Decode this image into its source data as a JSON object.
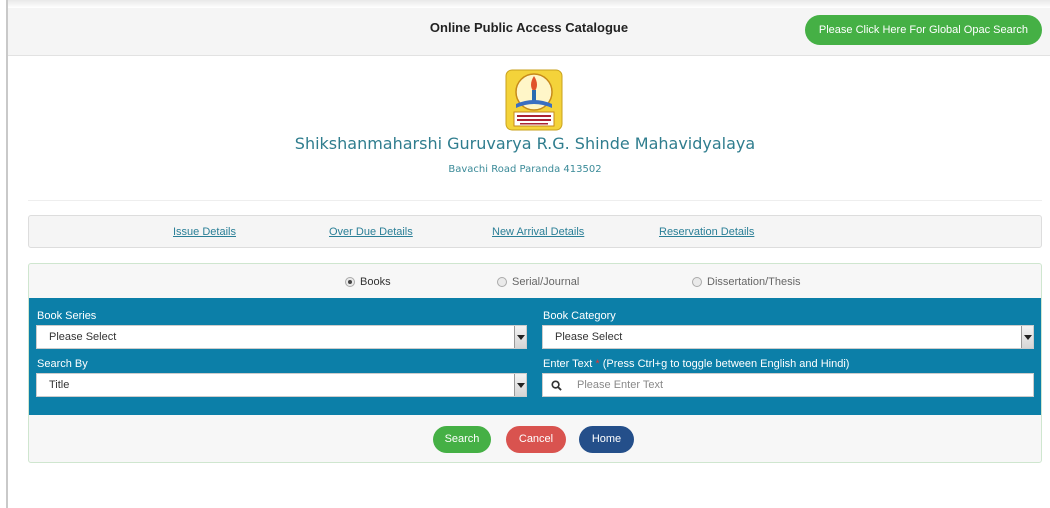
{
  "header": {
    "title": "Online Public Access Catalogue",
    "global_search_label": "Please Click Here For Global Opac Search"
  },
  "college": {
    "name": "Shikshanmaharshi Guruvarya R.G. Shinde Mahavidyalaya",
    "address": "Bavachi Road Paranda 413502"
  },
  "nav": {
    "issue": "Issue Details",
    "overdue": "Over Due Details",
    "new_arrival": "New Arrival Details",
    "reservation": "Reservation Details"
  },
  "material_types": {
    "books": "Books",
    "serial": "Serial/Journal",
    "dissertation": "Dissertation/Thesis",
    "selected": "Books"
  },
  "form": {
    "book_series_label": "Book Series",
    "book_series_value": "Please Select",
    "book_category_label": "Book Category",
    "book_category_value": "Please Select",
    "search_by_label": "Search By",
    "search_by_value": "Title",
    "enter_text_label": "Enter Text",
    "required_mark": "*",
    "enter_text_hint": "(Press Ctrl+g to toggle between English and Hindi)",
    "enter_text_placeholder": "Please Enter Text"
  },
  "buttons": {
    "search": "Search",
    "cancel": "Cancel",
    "home": "Home"
  },
  "colors": {
    "accent_blue": "#0c7fa8",
    "green": "#45b045",
    "red": "#d9534f",
    "navy": "#244f8a",
    "link": "#2a7f97"
  }
}
